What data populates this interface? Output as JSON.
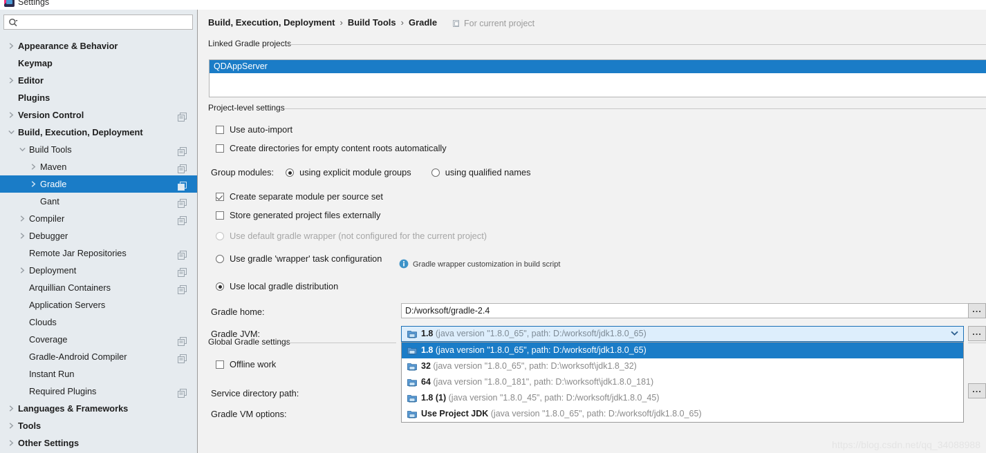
{
  "window": {
    "title": "Settings",
    "icon": "intellij-logo-icon"
  },
  "sidebar": {
    "search": {
      "placeholder": "",
      "value": "",
      "icon": "search-icon"
    },
    "items": [
      {
        "label": "Appearance & Behavior",
        "level": 0,
        "arrow": "right",
        "bold": true,
        "copy": false,
        "selected": false
      },
      {
        "label": "Keymap",
        "level": 0,
        "arrow": "none",
        "bold": true,
        "copy": false,
        "selected": false
      },
      {
        "label": "Editor",
        "level": 0,
        "arrow": "right",
        "bold": true,
        "copy": false,
        "selected": false
      },
      {
        "label": "Plugins",
        "level": 0,
        "arrow": "none",
        "bold": true,
        "copy": false,
        "selected": false
      },
      {
        "label": "Version Control",
        "level": 0,
        "arrow": "right",
        "bold": true,
        "copy": true,
        "selected": false
      },
      {
        "label": "Build, Execution, Deployment",
        "level": 0,
        "arrow": "down",
        "bold": true,
        "copy": false,
        "selected": false
      },
      {
        "label": "Build Tools",
        "level": 1,
        "arrow": "down",
        "bold": false,
        "copy": true,
        "selected": false
      },
      {
        "label": "Maven",
        "level": 2,
        "arrow": "right",
        "bold": false,
        "copy": true,
        "selected": false
      },
      {
        "label": "Gradle",
        "level": 2,
        "arrow": "right",
        "bold": false,
        "copy": true,
        "selected": true
      },
      {
        "label": "Gant",
        "level": 2,
        "arrow": "none",
        "bold": false,
        "copy": true,
        "selected": false
      },
      {
        "label": "Compiler",
        "level": 1,
        "arrow": "right",
        "bold": false,
        "copy": true,
        "selected": false
      },
      {
        "label": "Debugger",
        "level": 1,
        "arrow": "right",
        "bold": false,
        "copy": false,
        "selected": false
      },
      {
        "label": "Remote Jar Repositories",
        "level": 1,
        "arrow": "none",
        "bold": false,
        "copy": true,
        "selected": false
      },
      {
        "label": "Deployment",
        "level": 1,
        "arrow": "right",
        "bold": false,
        "copy": true,
        "selected": false
      },
      {
        "label": "Arquillian Containers",
        "level": 1,
        "arrow": "none",
        "bold": false,
        "copy": true,
        "selected": false
      },
      {
        "label": "Application Servers",
        "level": 1,
        "arrow": "none",
        "bold": false,
        "copy": false,
        "selected": false
      },
      {
        "label": "Clouds",
        "level": 1,
        "arrow": "none",
        "bold": false,
        "copy": false,
        "selected": false
      },
      {
        "label": "Coverage",
        "level": 1,
        "arrow": "none",
        "bold": false,
        "copy": true,
        "selected": false
      },
      {
        "label": "Gradle-Android Compiler",
        "level": 1,
        "arrow": "none",
        "bold": false,
        "copy": true,
        "selected": false
      },
      {
        "label": "Instant Run",
        "level": 1,
        "arrow": "none",
        "bold": false,
        "copy": false,
        "selected": false
      },
      {
        "label": "Required Plugins",
        "level": 1,
        "arrow": "none",
        "bold": false,
        "copy": true,
        "selected": false
      },
      {
        "label": "Languages & Frameworks",
        "level": 0,
        "arrow": "right",
        "bold": true,
        "copy": false,
        "selected": false
      },
      {
        "label": "Tools",
        "level": 0,
        "arrow": "right",
        "bold": true,
        "copy": false,
        "selected": false
      },
      {
        "label": "Other Settings",
        "level": 0,
        "arrow": "right",
        "bold": true,
        "copy": false,
        "selected": false
      }
    ]
  },
  "breadcrumb": {
    "part1": "Build, Execution, Deployment",
    "sep1": "›",
    "part2": "Build Tools",
    "sep2": "›",
    "part3": "Gradle",
    "note": "For current project",
    "note_icon": "project-scope-icon"
  },
  "linked_projects": {
    "section_title": "Linked Gradle projects",
    "items": [
      {
        "label": "QDAppServer",
        "selected": true
      }
    ]
  },
  "project_settings": {
    "section_title": "Project-level settings",
    "use_auto_import": {
      "label": "Use auto-import",
      "checked": false
    },
    "create_dirs": {
      "label": "Create directories for empty content roots automatically",
      "checked": false
    },
    "group_modules": {
      "label": "Group modules:",
      "option_explicit": {
        "label": "using explicit module groups",
        "selected": true
      },
      "option_qualified": {
        "label": "using qualified names",
        "selected": false
      }
    },
    "create_separate_module": {
      "label": "Create separate module per source set",
      "checked": true
    },
    "store_external": {
      "label": "Store generated project files externally",
      "checked": false
    },
    "distribution": {
      "default_wrapper": {
        "label": "Use default gradle wrapper (not configured for the current project)",
        "selected": false,
        "disabled": true
      },
      "task_wrapper": {
        "label": "Use gradle 'wrapper' task configuration",
        "selected": false,
        "disabled": false
      },
      "local_distribution": {
        "label": "Use local gradle distribution",
        "selected": true,
        "disabled": false
      }
    },
    "wrapper_info": {
      "label": "Gradle wrapper customization in build script",
      "icon": "info-icon"
    },
    "gradle_home": {
      "label": "Gradle home:",
      "value": "D:/worksoft/gradle-2.4",
      "browse": "..."
    },
    "gradle_jvm": {
      "label": "Gradle JVM:"
    }
  },
  "gradle_jvm_combo": {
    "selected_name": "1.8",
    "selected_desc": "(java version \"1.8.0_65\", path: D:/worksoft/jdk1.8.0_65)",
    "arrow_icon": "chevron-down-icon",
    "icon": "jdk-folder-icon",
    "browse": "...",
    "options": [
      {
        "name": "1.8",
        "desc": "(java version \"1.8.0_65\", path: D:/worksoft/jdk1.8.0_65)",
        "selected": true
      },
      {
        "name": "32",
        "desc": "(java version \"1.8.0_65\", path: D:\\worksoft\\jdk1.8_32)",
        "selected": false
      },
      {
        "name": "64",
        "desc": "(java version \"1.8.0_181\", path: D:\\worksoft\\jdk1.8.0_181)",
        "selected": false
      },
      {
        "name": "1.8 (1)",
        "desc": "(java version \"1.8.0_45\", path: D:/worksoft/jdk1.8.0_45)",
        "selected": false
      },
      {
        "name": "Use Project JDK",
        "desc": "(java version \"1.8.0_65\", path: D:/worksoft/jdk1.8.0_65)",
        "selected": false
      }
    ]
  },
  "global_settings": {
    "section_title": "Global Gradle settings",
    "offline_work": {
      "label": "Offline work",
      "checked": false
    },
    "service_dir": {
      "label": "Service directory path:",
      "value": "",
      "browse": "..."
    },
    "vm_options": {
      "label": "Gradle VM options:",
      "value": ""
    }
  },
  "watermark": {
    "text": "https://blog.csdn.net/qq_34088988"
  },
  "colors": {
    "accent": "#1a7cc7",
    "sidebar_bg": "#e6ebef",
    "content_bg": "#f2f2f2",
    "combo_focus_bg": "#ddeefc"
  }
}
